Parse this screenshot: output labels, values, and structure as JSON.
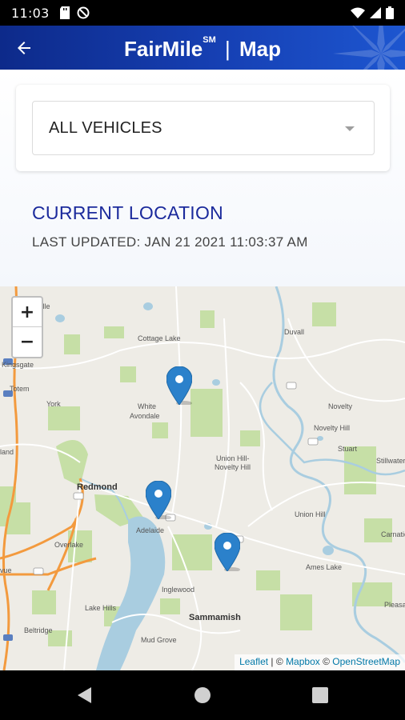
{
  "status_bar": {
    "time": "11:03",
    "left_icons": [
      "sd-card-icon",
      "blocked-icon"
    ],
    "right_icons": [
      "wifi-icon",
      "signal-icon",
      "battery-icon"
    ]
  },
  "app_bar": {
    "title_brand": "FairMile",
    "title_mark": "SM",
    "title_separator": "|",
    "title_page": "Map",
    "back_icon": "arrow-left-icon"
  },
  "vehicle_select": {
    "value": "ALL VEHICLES"
  },
  "location": {
    "title": "CURRENT LOCATION",
    "last_updated": "LAST UPDATED: JAN 21 2021 11:03:37 AM"
  },
  "map": {
    "zoom_in": "+",
    "zoom_out": "−",
    "attribution": {
      "leaflet": "Leaflet",
      "sep1": " | © ",
      "mapbox": "Mapbox",
      "sep2": " © ",
      "osm": "OpenStreetMap"
    },
    "labels": {
      "woodinville": "ilnville",
      "cottage_lake": "Cottage Lake",
      "duvall": "Duvall",
      "kingsgate": "Kingsgate",
      "totem": "Totem",
      "york": "York",
      "white": "White",
      "avondale": "Avondale",
      "novelty": "Novelty",
      "novelty_hill": "Novelty Hill",
      "stuart": "Stuart",
      "stillwater": "Stillwater",
      "union_hill": "Union Hill-",
      "novelty_hill2": "Novelty Hill",
      "redmond": "Redmond",
      "adelaide": "Adelaide",
      "union_hill_town": "Union Hill",
      "carnation": "Carnatio",
      "overlake": "Overlake",
      "ames_lake": "Ames Lake",
      "inglewood": "Inglewood",
      "sammamish": "Sammamish",
      "lake_hills": "Lake Hills",
      "beltridge": "Beltridge",
      "mud_grove": "Mud Grove",
      "pleasant": "Pleasan",
      "land": "land",
      "vue": "vue"
    },
    "markers": [
      "vehicle-marker-1",
      "vehicle-marker-2",
      "vehicle-marker-3"
    ],
    "colors": {
      "water": "#a9cde0",
      "park": "#c6dfa6",
      "land": "#eeece6",
      "road_major": "#f39a3e",
      "road_minor": "#ffffff",
      "marker": "#2b81cb"
    }
  },
  "nav_bar": {
    "icons": [
      "back-triangle-icon",
      "home-circle-icon",
      "recents-square-icon"
    ]
  },
  "colors": {
    "app_bar": "#1640b4",
    "accent_title": "#1b2a9c"
  }
}
